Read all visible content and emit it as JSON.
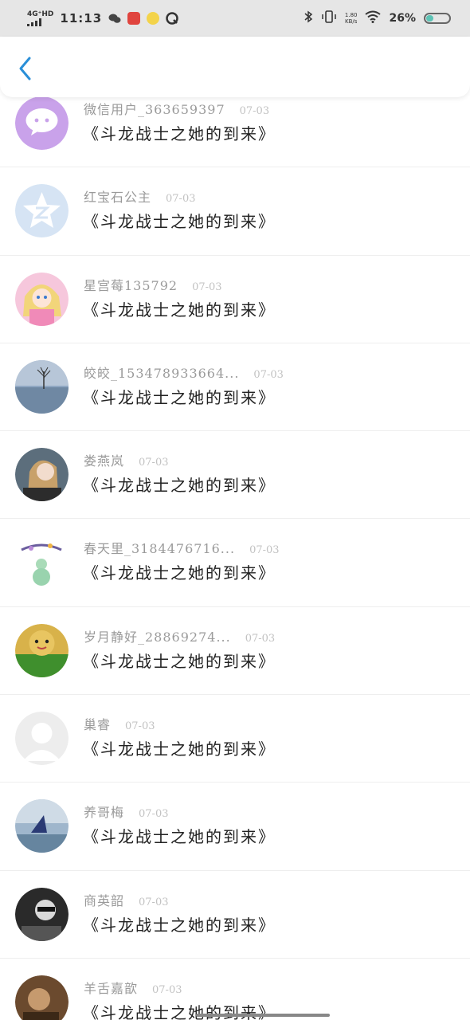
{
  "status_bar": {
    "network": "4G⁺HD",
    "time": "11:13",
    "speed_value": "1.80",
    "speed_unit": "KB/s",
    "battery": "26%",
    "battery_fraction": 0.26
  },
  "header": {
    "back_icon": "chevron-left-icon",
    "accent": "#2a8fd8"
  },
  "comments": [
    {
      "name": "微信用户_363659397",
      "date": "07-03",
      "title": "《斗龙战士之她的到来》",
      "avatar": "wechat-purple"
    },
    {
      "name": "红宝石公主",
      "date": "07-03",
      "title": "《斗龙战士之她的到来》",
      "avatar": "qq-star"
    },
    {
      "name": "星宫莓135792",
      "date": "07-03",
      "title": "《斗龙战士之她的到来》",
      "avatar": "anime-girl"
    },
    {
      "name": "皎皎_153478933664...",
      "date": "07-03",
      "title": "《斗龙战士之她的到来》",
      "avatar": "lake-tree"
    },
    {
      "name": "娄燕岚",
      "date": "07-03",
      "title": "《斗龙战士之她的到来》",
      "avatar": "woman-photo"
    },
    {
      "name": "春天里_3184476716...",
      "date": "07-03",
      "title": "《斗龙战士之她的到来》",
      "avatar": "gourd-vase"
    },
    {
      "name": "岁月静好_28869274...",
      "date": "07-03",
      "title": "《斗龙战士之她的到来》",
      "avatar": "cartoon-green"
    },
    {
      "name": "巢睿",
      "date": "07-03",
      "title": "《斗龙战士之她的到来》",
      "avatar": "default-grey"
    },
    {
      "name": "养哥梅",
      "date": "07-03",
      "title": "《斗龙战士之她的到来》",
      "avatar": "sky-bird"
    },
    {
      "name": "商英韶",
      "date": "07-03",
      "title": "《斗龙战士之她的到来》",
      "avatar": "dark-man"
    },
    {
      "name": "羊舌嘉歆",
      "date": "07-03",
      "title": "《斗龙战士之她的到来》",
      "avatar": "brown-photo"
    }
  ]
}
